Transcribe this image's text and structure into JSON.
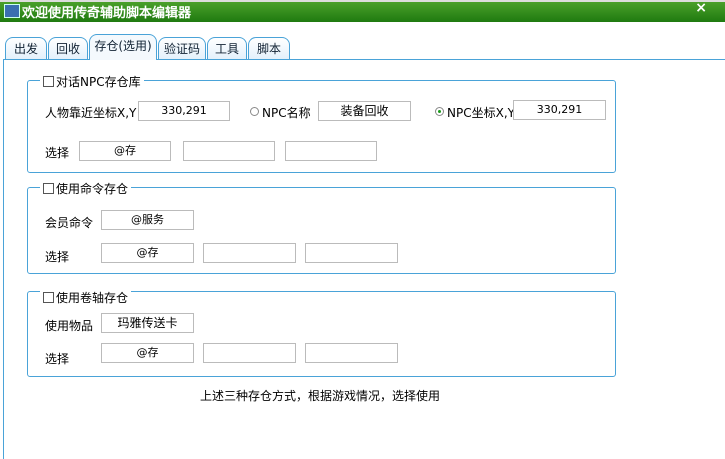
{
  "window": {
    "title": "欢迎使用传奇辅助脚本编辑器",
    "close": "×"
  },
  "tabs": [
    "出发",
    "回收",
    "存仓(选用)",
    "验证码",
    "工具",
    "脚本"
  ],
  "active_tab": "存仓(选用)",
  "group_npc": {
    "label": "对话NPC存仓库",
    "checked": false,
    "player_coord_label": "人物靠近坐标X,Y",
    "player_coord": "330,291",
    "npc_name_label": "NPC名称",
    "npc_name": "装备回收",
    "npc_name_selected": false,
    "npc_coord_label": "NPC坐标X,Y",
    "npc_coord": "330,291",
    "npc_coord_selected": true,
    "select_label": "选择",
    "selects": [
      "@存",
      "",
      ""
    ]
  },
  "group_cmd": {
    "label": "使用命令存仓",
    "checked": false,
    "cmd_label": "会员命令",
    "cmd": "@服务",
    "select_label": "选择",
    "selects": [
      "@存",
      "",
      ""
    ]
  },
  "group_scroll": {
    "label": "使用卷轴存仓",
    "checked": false,
    "item_label": "使用物品",
    "item": "玛雅传送卡",
    "select_label": "选择",
    "selects": [
      "@存",
      "",
      ""
    ]
  },
  "footer": "上述三种存仓方式，根据游戏情况，选择使用"
}
